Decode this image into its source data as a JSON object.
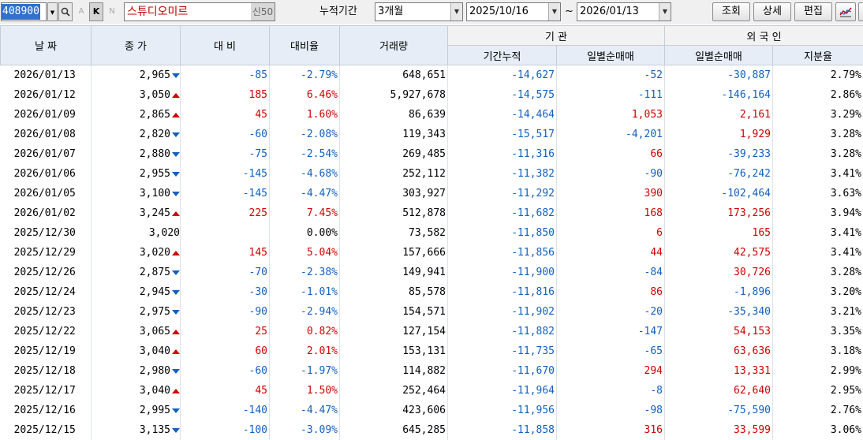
{
  "toolbar": {
    "code": "408900",
    "btn_a": "A",
    "btn_k": "K",
    "btn_n": "N",
    "name": "스튜디오미르",
    "sin_badge": "신50",
    "period_label": "누적기간",
    "period_value": "3개월",
    "date_from": "2025/10/16",
    "tilde": "~",
    "date_to": "2026/01/13",
    "btn_query": "조회",
    "btn_detail": "상세",
    "btn_edit": "편집"
  },
  "headers": {
    "date": "날 짜",
    "close": "종 가",
    "change": "대 비",
    "rate": "대비율",
    "volume": "거래량",
    "inst_group": "기 관",
    "inst_cum": "기간누적",
    "inst_daily": "일별순매매",
    "foreign_group": "외 국 인",
    "foreign_daily": "일별순매매",
    "foreign_share": "지분율"
  },
  "rows": [
    {
      "date": "2026/01/13",
      "close": "2,965",
      "dir": "down",
      "change": "-85",
      "rate": "-2.79%",
      "volume": "648,651",
      "inst_cum": "-14,627",
      "inst_daily": "-52",
      "inst_dir": "down",
      "for_daily": "-30,887",
      "for_dir": "down",
      "share": "2.79%"
    },
    {
      "date": "2026/01/12",
      "close": "3,050",
      "dir": "up",
      "change": "185",
      "rate": "6.46%",
      "volume": "5,927,678",
      "inst_cum": "-14,575",
      "inst_daily": "-111",
      "inst_dir": "down",
      "for_daily": "-146,164",
      "for_dir": "down",
      "share": "2.86%"
    },
    {
      "date": "2026/01/09",
      "close": "2,865",
      "dir": "up",
      "change": "45",
      "rate": "1.60%",
      "volume": "86,639",
      "inst_cum": "-14,464",
      "inst_daily": "1,053",
      "inst_dir": "up",
      "for_daily": "2,161",
      "for_dir": "up",
      "share": "3.29%"
    },
    {
      "date": "2026/01/08",
      "close": "2,820",
      "dir": "down",
      "change": "-60",
      "rate": "-2.08%",
      "volume": "119,343",
      "inst_cum": "-15,517",
      "inst_daily": "-4,201",
      "inst_dir": "down",
      "for_daily": "1,929",
      "for_dir": "up",
      "share": "3.28%"
    },
    {
      "date": "2026/01/07",
      "close": "2,880",
      "dir": "down",
      "change": "-75",
      "rate": "-2.54%",
      "volume": "269,485",
      "inst_cum": "-11,316",
      "inst_daily": "66",
      "inst_dir": "up",
      "for_daily": "-39,233",
      "for_dir": "down",
      "share": "3.28%"
    },
    {
      "date": "2026/01/06",
      "close": "2,955",
      "dir": "down",
      "change": "-145",
      "rate": "-4.68%",
      "volume": "252,112",
      "inst_cum": "-11,382",
      "inst_daily": "-90",
      "inst_dir": "down",
      "for_daily": "-76,242",
      "for_dir": "down",
      "share": "3.41%"
    },
    {
      "date": "2026/01/05",
      "close": "3,100",
      "dir": "down",
      "change": "-145",
      "rate": "-4.47%",
      "volume": "303,927",
      "inst_cum": "-11,292",
      "inst_daily": "390",
      "inst_dir": "up",
      "for_daily": "-102,464",
      "for_dir": "down",
      "share": "3.63%"
    },
    {
      "date": "2026/01/02",
      "close": "3,245",
      "dir": "up",
      "change": "225",
      "rate": "7.45%",
      "volume": "512,878",
      "inst_cum": "-11,682",
      "inst_daily": "168",
      "inst_dir": "up",
      "for_daily": "173,256",
      "for_dir": "up",
      "share": "3.94%"
    },
    {
      "date": "2025/12/30",
      "close": "3,020",
      "dir": "flat",
      "change": "",
      "rate": "0.00%",
      "volume": "73,582",
      "inst_cum": "-11,850",
      "inst_daily": "6",
      "inst_dir": "up",
      "for_daily": "165",
      "for_dir": "up",
      "share": "3.41%"
    },
    {
      "date": "2025/12/29",
      "close": "3,020",
      "dir": "up",
      "change": "145",
      "rate": "5.04%",
      "volume": "157,666",
      "inst_cum": "-11,856",
      "inst_daily": "44",
      "inst_dir": "up",
      "for_daily": "42,575",
      "for_dir": "up",
      "share": "3.41%"
    },
    {
      "date": "2025/12/26",
      "close": "2,875",
      "dir": "down",
      "change": "-70",
      "rate": "-2.38%",
      "volume": "149,941",
      "inst_cum": "-11,900",
      "inst_daily": "-84",
      "inst_dir": "down",
      "for_daily": "30,726",
      "for_dir": "up",
      "share": "3.28%"
    },
    {
      "date": "2025/12/24",
      "close": "2,945",
      "dir": "down",
      "change": "-30",
      "rate": "-1.01%",
      "volume": "85,578",
      "inst_cum": "-11,816",
      "inst_daily": "86",
      "inst_dir": "up",
      "for_daily": "-1,896",
      "for_dir": "down",
      "share": "3.20%"
    },
    {
      "date": "2025/12/23",
      "close": "2,975",
      "dir": "down",
      "change": "-90",
      "rate": "-2.94%",
      "volume": "154,571",
      "inst_cum": "-11,902",
      "inst_daily": "-20",
      "inst_dir": "down",
      "for_daily": "-35,340",
      "for_dir": "down",
      "share": "3.21%"
    },
    {
      "date": "2025/12/22",
      "close": "3,065",
      "dir": "up",
      "change": "25",
      "rate": "0.82%",
      "volume": "127,154",
      "inst_cum": "-11,882",
      "inst_daily": "-147",
      "inst_dir": "down",
      "for_daily": "54,153",
      "for_dir": "up",
      "share": "3.35%"
    },
    {
      "date": "2025/12/19",
      "close": "3,040",
      "dir": "up",
      "change": "60",
      "rate": "2.01%",
      "volume": "153,131",
      "inst_cum": "-11,735",
      "inst_daily": "-65",
      "inst_dir": "down",
      "for_daily": "63,636",
      "for_dir": "up",
      "share": "3.18%"
    },
    {
      "date": "2025/12/18",
      "close": "2,980",
      "dir": "down",
      "change": "-60",
      "rate": "-1.97%",
      "volume": "114,882",
      "inst_cum": "-11,670",
      "inst_daily": "294",
      "inst_dir": "up",
      "for_daily": "13,331",
      "for_dir": "up",
      "share": "2.99%"
    },
    {
      "date": "2025/12/17",
      "close": "3,040",
      "dir": "up",
      "change": "45",
      "rate": "1.50%",
      "volume": "252,464",
      "inst_cum": "-11,964",
      "inst_daily": "-8",
      "inst_dir": "down",
      "for_daily": "62,640",
      "for_dir": "up",
      "share": "2.95%"
    },
    {
      "date": "2025/12/16",
      "close": "2,995",
      "dir": "down",
      "change": "-140",
      "rate": "-4.47%",
      "volume": "423,606",
      "inst_cum": "-11,956",
      "inst_daily": "-98",
      "inst_dir": "down",
      "for_daily": "-75,590",
      "for_dir": "down",
      "share": "2.76%"
    },
    {
      "date": "2025/12/15",
      "close": "3,135",
      "dir": "down",
      "change": "-100",
      "rate": "-3.09%",
      "volume": "645,285",
      "inst_cum": "-11,858",
      "inst_daily": "316",
      "inst_dir": "up",
      "for_daily": "33,599",
      "for_dir": "up",
      "share": "3.06%"
    }
  ],
  "colors": {
    "up": "#d00000",
    "down": "#1060c0",
    "header_bg": "#e6edf7"
  }
}
